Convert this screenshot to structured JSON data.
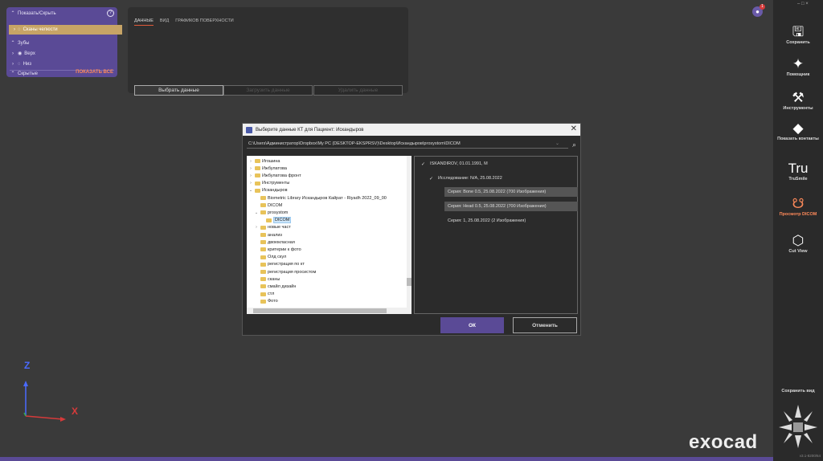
{
  "left_panel": {
    "show_hide": "Показать/Скрыть",
    "help": "?",
    "selected_item": "Сканы челюсти",
    "teeth": "Зубы",
    "upper": "Верх",
    "lower": "Низ",
    "hidden": "Скрытые",
    "show_all": "ПОКАЗАТЬ ВСЕ"
  },
  "data_panel": {
    "tabs": [
      "ДАННЫЕ",
      "ВИД",
      "ГРАФИКОВ ПОВЕРХНОСТИ"
    ],
    "select_data": "Выбрать данные",
    "load_data": "Загрузить данные",
    "delete_data": "Удалить данные"
  },
  "dialog": {
    "title": "Выберите данные КТ для Пациент: Искандыров",
    "close": "✕",
    "path": "C:\\Users\\Администратор\\Dropbox\\My PC (DESKTOP-EKSPRSV)\\Desktop\\Искандыров\\prosystom\\DICOM",
    "tree": [
      {
        "label": "Игошина",
        "indent": 0,
        "chev": "›"
      },
      {
        "label": "Ижбулатова",
        "indent": 0,
        "chev": "›"
      },
      {
        "label": "Ижбулатова фронт",
        "indent": 0,
        "chev": "›"
      },
      {
        "label": "Инструменты",
        "indent": 0,
        "chev": "›"
      },
      {
        "label": "Искандыров",
        "indent": 0,
        "chev": "⌄"
      },
      {
        "label": "Biometric Library Искандыров  Кайрат - Riyadh 2022_09_00",
        "indent": 1,
        "chev": ""
      },
      {
        "label": "DICOM",
        "indent": 1,
        "chev": ""
      },
      {
        "label": "prosystom",
        "indent": 1,
        "chev": "⌄"
      },
      {
        "label": "DICOM",
        "indent": 2,
        "chev": "",
        "selected": true
      },
      {
        "label": "новые част",
        "indent": 1,
        "chev": "›"
      },
      {
        "label": "анализ",
        "indent": 1,
        "chev": ""
      },
      {
        "label": "двоюкласная",
        "indent": 1,
        "chev": ""
      },
      {
        "label": "критерии к фото",
        "indent": 1,
        "chev": ""
      },
      {
        "label": "Олд скул",
        "indent": 1,
        "chev": ""
      },
      {
        "label": "регистрация по кт",
        "indent": 1,
        "chev": ""
      },
      {
        "label": "регистрация просистом",
        "indent": 1,
        "chev": ""
      },
      {
        "label": "сканы",
        "indent": 1,
        "chev": ""
      },
      {
        "label": "смайл дизайн",
        "indent": 1,
        "chev": ""
      },
      {
        "label": "стл",
        "indent": 1,
        "chev": ""
      },
      {
        "label": "Фото",
        "indent": 1,
        "chev": ""
      }
    ],
    "patient": "ISKANDIROV, 01.01.1991, M",
    "study": "Исследование: N/A, 25.08.2022",
    "series": [
      {
        "label": "Серия:   Bone 0.5, 25.08.2022 (700 Изображения)",
        "selected": true
      },
      {
        "label": "Серия:   Head 0.5, 25.08.2022 (700 Изображения)",
        "selected": true
      },
      {
        "label": "Серия:   1, 25.08.2022 (2 Изображения)",
        "selected": false
      }
    ],
    "ok": "ОК",
    "cancel": "Отменить"
  },
  "right_toolbar": {
    "top_controls": "– □ ×",
    "items": [
      {
        "label": "Сохранить",
        "icon": "save-icon",
        "glyph": "🖫"
      },
      {
        "label": "Помощник",
        "icon": "wizard-wand-icon",
        "glyph": "✦"
      },
      {
        "label": "Инструменты",
        "icon": "tools-icon",
        "glyph": "⚒"
      },
      {
        "label": "Показать контакты",
        "icon": "contacts-icon",
        "glyph": "◆"
      },
      {
        "label": "TruSmile",
        "icon": "trusmile-icon",
        "glyph": "Tru"
      },
      {
        "label": "Просмотр DICOM",
        "icon": "dicom-jaw-icon",
        "glyph": "☋",
        "active": true
      },
      {
        "label": "Cut View",
        "icon": "cut-view-icon",
        "glyph": "⬡"
      }
    ],
    "save_view": "Сохранить вид",
    "version": "v3.1-8200/64"
  },
  "notification_count": "1",
  "logo": "exocad",
  "axes": {
    "z": "Z",
    "x": "X"
  },
  "colors": {
    "accent": "#5a4a96",
    "highlight": "#c7a466",
    "active": "#ff8a5a"
  }
}
